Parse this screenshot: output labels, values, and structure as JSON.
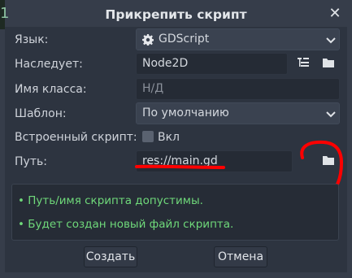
{
  "dialog": {
    "title": "Прикрепить скрипт",
    "close_icon": "close-icon"
  },
  "form": {
    "language": {
      "label": "Язык:",
      "value": "GDScript",
      "icon": "gear-icon"
    },
    "inherits": {
      "label": "Наследует:",
      "value": "Node2D"
    },
    "class_name": {
      "label": "Имя класса:",
      "placeholder": "Н/Д"
    },
    "template": {
      "label": "Шаблон:",
      "value": "По умолчанию"
    },
    "builtin": {
      "label": "Встроенный скрипт:",
      "checkbox_label": "Вкл",
      "checked": false
    },
    "path": {
      "label": "Путь:",
      "value": "res://main.gd"
    }
  },
  "info": {
    "lines": [
      "• Путь/имя скрипта допустимы.",
      "• Будет создан новый файл скрипта."
    ],
    "color": "#6fd97a"
  },
  "buttons": {
    "create": "Создать",
    "cancel": "Отмена"
  },
  "annotation": {
    "color": "#ff0000"
  }
}
